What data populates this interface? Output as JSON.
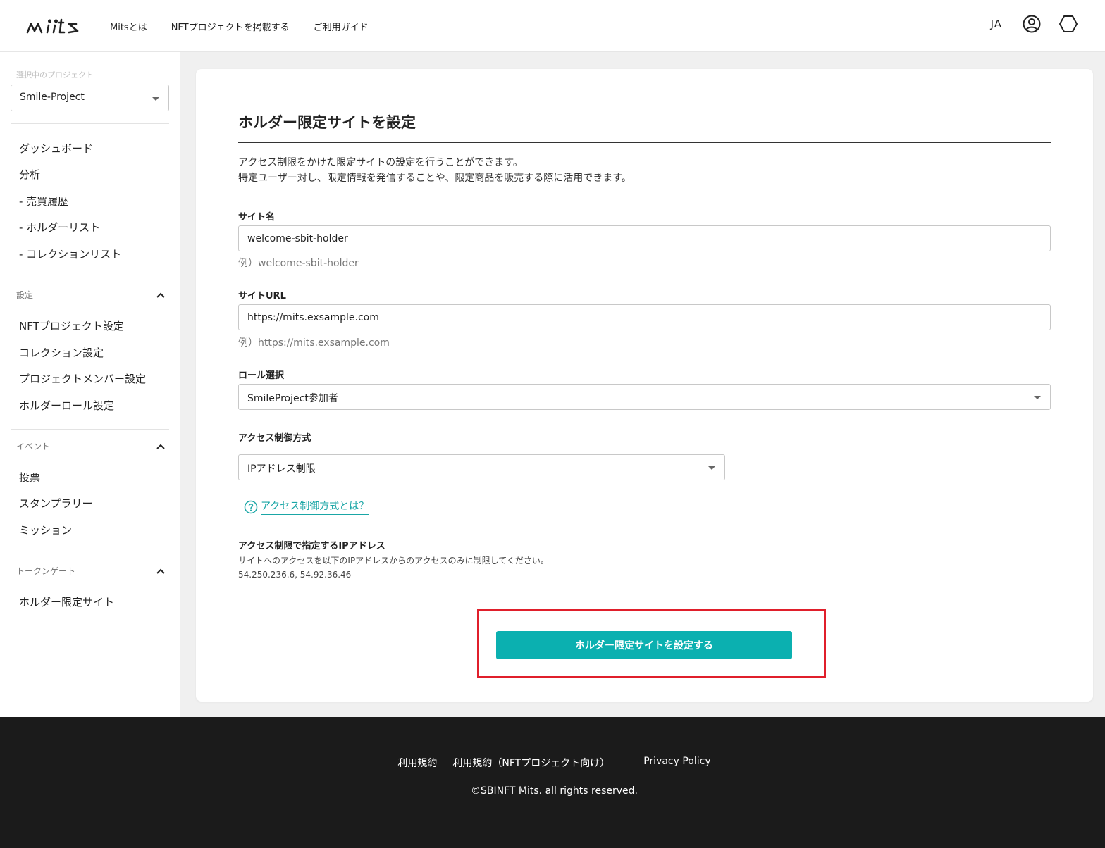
{
  "header": {
    "nav": [
      "Mitsとは",
      "NFTプロジェクトを掲載する",
      "ご利用ガイド"
    ],
    "lang": "JA"
  },
  "sidebar": {
    "project_label": "選択中のプロジェクト",
    "project_value": "Smile-Project",
    "main_items": [
      "ダッシュボード",
      "分析",
      "- 売買履歴",
      "- ホルダーリスト",
      "- コレクションリスト"
    ],
    "sections": [
      {
        "title": "設定",
        "items": [
          "NFTプロジェクト設定",
          "コレクション設定",
          "プロジェクトメンバー設定",
          "ホルダーロール設定"
        ]
      },
      {
        "title": "イベント",
        "items": [
          "投票",
          "スタンプラリー",
          "ミッション"
        ]
      },
      {
        "title": "トークンゲート",
        "items": [
          "ホルダー限定サイト"
        ]
      }
    ]
  },
  "main": {
    "title": "ホルダー限定サイトを設定",
    "description_line1": "アクセス制限をかけた限定サイトの設定を行うことができます。",
    "description_line2": "特定ユーザー対し、限定情報を発信することや、限定商品を販売する際に活用できます。",
    "site_name": {
      "label": "サイト名",
      "value": "welcome-sbit-holder",
      "hint": "例）welcome-sbit-holder"
    },
    "site_url": {
      "label": "サイトURL",
      "value": "https://mits.exsample.com",
      "hint": "例）https://mits.exsample.com"
    },
    "role": {
      "label": "ロール選択",
      "value": "SmileProject参加者"
    },
    "access_method": {
      "label": "アクセス制御方式",
      "value": "IPアドレス制限"
    },
    "help_link": "アクセス制御方式とは？",
    "ip": {
      "title": "アクセス制限で指定するIPアドレス",
      "description": "サイトへのアクセスを以下のIPアドレスからのアクセスのみに制限してください。",
      "value": "54.250.236.6, 54.92.36.46"
    },
    "submit_label": "ホルダー限定サイトを設定する"
  },
  "footer": {
    "links": [
      "利用規約",
      "利用規約（NFTプロジェクト向け）",
      "Privacy Policy"
    ],
    "copyright": "©SBINFT Mits. all rights reserved."
  },
  "colors": {
    "accent": "#0bb0b0",
    "highlight": "#e01f2b",
    "footer_bg": "#1b1b1b"
  }
}
